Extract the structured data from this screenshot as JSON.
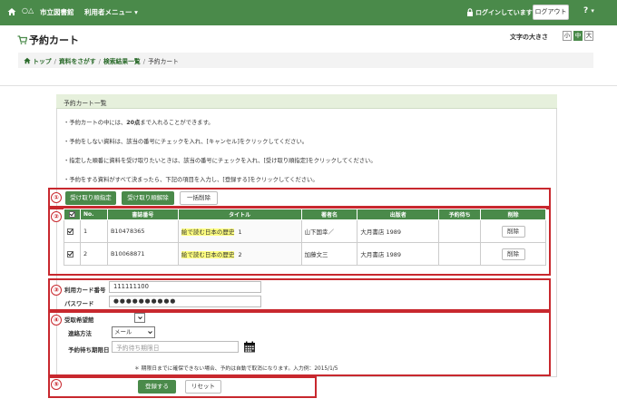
{
  "navbar": {
    "logo_mark": "○△",
    "library_name": "市立図書館",
    "menu_label": "利用者メニュー",
    "menu_caret": "▾",
    "login_status": "ログインしています",
    "logout_label": "ログアウト",
    "help_label": "?",
    "help_caret": "▾"
  },
  "page": {
    "title": "予約カート",
    "font_size_label": "文字の大きさ",
    "font_sizes": [
      "小",
      "中",
      "大"
    ],
    "font_size_selected": "中"
  },
  "breadcrumb": {
    "items": [
      "トップ",
      "資料をさがす",
      "検索結果一覧",
      "予約カート"
    ],
    "separator": "/"
  },
  "panel": {
    "heading": "予約カート一覧",
    "notes": [
      "・予約カートの中には、20点まで入れることができます。",
      "・予約をしない資料は、該当の番号にチェックを入れ、[キャンセル]をクリックしてください。",
      "・指定した順番に資料を受け取りたいときは、該当の番号にチェックを入れ、[受け取り順指定]をクリックしてください。",
      "・予約をする資料がすべて決まったら、下記の項目を入力し、[登録する]をクリックしてください。"
    ],
    "note1_pre": "・予約カートの中には、",
    "note1_bold": "20点",
    "note1_post": "まで入れることができます。"
  },
  "actions": {
    "order_button": "受け取り順指定",
    "order_cancel_button": "受け取り順解除",
    "bulk_delete_button": "一括削除"
  },
  "table": {
    "headers": [
      "",
      "No.",
      "書誌番号",
      "タイトル",
      "著者名",
      "出版者",
      "予約待ち",
      "削除"
    ],
    "rows": [
      {
        "checked": true,
        "no": "1",
        "bib_id": "B10478365",
        "title_hl": "絵で読む日本の歴史",
        "title_vol": "1",
        "author": "山下国幸／",
        "publisher": "大月書店 1989",
        "waiting": "",
        "delete_label": "削除"
      },
      {
        "checked": true,
        "no": "2",
        "bib_id": "B10068871",
        "title_hl": "絵で読む日本の歴史",
        "title_vol": "2",
        "author": "加藤文三",
        "publisher": "大月書店 1989",
        "waiting": "",
        "delete_label": "削除"
      }
    ]
  },
  "credentials": {
    "card_label": "利用カード番号",
    "card_value": "111111100",
    "password_label": "パスワード",
    "password_value": "●●●●●●●●●●"
  },
  "options": {
    "pickup_label": "受取希望館",
    "pickup_value": "",
    "contact_label": "連絡方法",
    "contact_value": "メール",
    "deadline_label": "予約待ち期限日",
    "deadline_placeholder": "予約待ち期限日",
    "footnote": "＊ 期限日までに確保できない場合、予約は自動で取消になります。入力例：2015/1/5"
  },
  "submit": {
    "register_button": "登録する",
    "reset_button": "リセット"
  },
  "markers": [
    "①",
    "②",
    "③",
    "④",
    "⑤"
  ],
  "colors": {
    "brand_green": "#4a8a4a",
    "highlight_red": "#c8282e",
    "title_highlight": "#ffff80"
  }
}
